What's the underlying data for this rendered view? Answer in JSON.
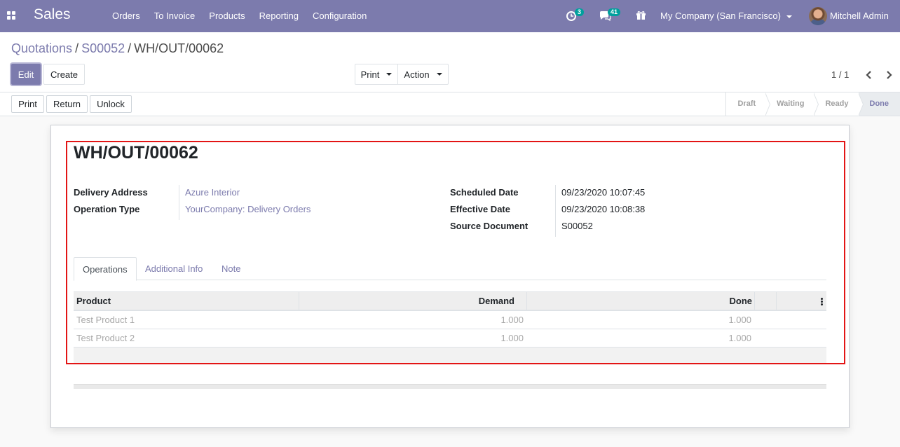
{
  "navbar": {
    "app_name": "Sales",
    "menu": [
      "Orders",
      "To Invoice",
      "Products",
      "Reporting",
      "Configuration"
    ],
    "activity_count": "3",
    "messages_count": "41",
    "company": "My Company (San Francisco)",
    "user": "Mitchell Admin"
  },
  "breadcrumb": {
    "items": [
      "Quotations",
      "S00052"
    ],
    "current": "WH/OUT/00062"
  },
  "control_panel": {
    "edit_label": "Edit",
    "create_label": "Create",
    "print_label": "Print",
    "action_label": "Action",
    "pager": "1 / 1"
  },
  "statusbar": {
    "print_label": "Print",
    "return_label": "Return",
    "unlock_label": "Unlock",
    "stages": [
      "Draft",
      "Waiting",
      "Ready",
      "Done"
    ],
    "active_stage": "Done"
  },
  "record": {
    "name": "WH/OUT/00062",
    "fields_left": [
      {
        "label": "Delivery Address",
        "value": "Azure Interior"
      },
      {
        "label": "Operation Type",
        "value": "YourCompany: Delivery Orders"
      }
    ],
    "fields_right": [
      {
        "label": "Scheduled Date",
        "value": "09/23/2020 10:07:45"
      },
      {
        "label": "Effective Date",
        "value": "09/23/2020 10:08:38"
      },
      {
        "label": "Source Document",
        "value": "S00052"
      }
    ],
    "tabs": [
      "Operations",
      "Additional Info",
      "Note"
    ],
    "active_tab": "Operations",
    "table": {
      "columns": [
        "Product",
        "Demand",
        "Done"
      ],
      "rows": [
        {
          "product": "Test Product 1",
          "demand": "1.000",
          "done": "1.000"
        },
        {
          "product": "Test Product 2",
          "demand": "1.000",
          "done": "1.000"
        }
      ]
    }
  },
  "colors": {
    "brand": "#7c7bad",
    "highlight_frame": "#e31515",
    "badge": "#00a09d"
  }
}
